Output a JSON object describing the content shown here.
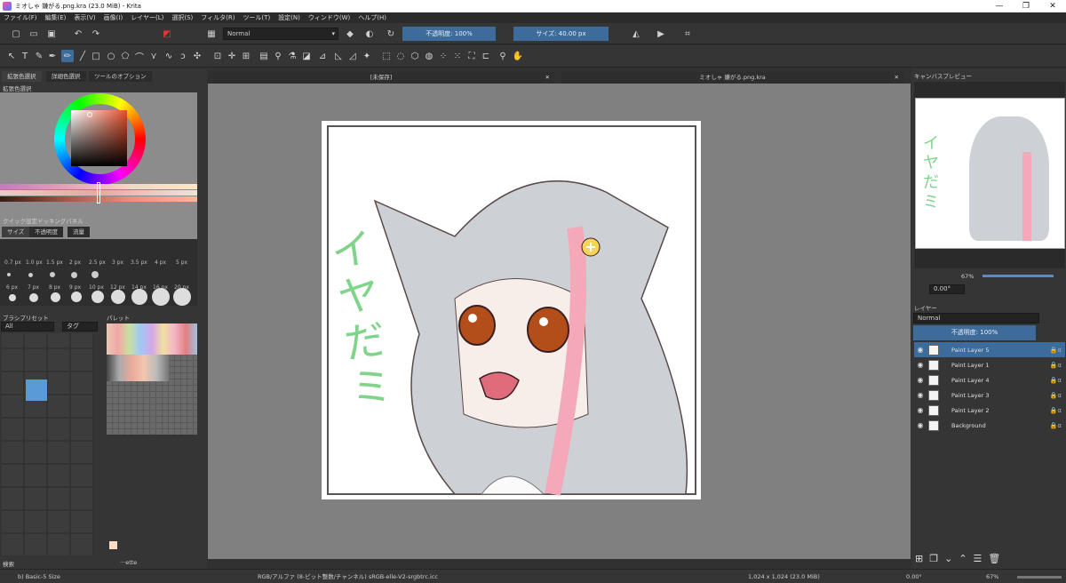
{
  "window": {
    "title": "ミオしゃ 嫌がる.png.kra (23.0 MiB) - Krita",
    "minimize": "—",
    "maximize": "❐",
    "close": "✕"
  },
  "menu": [
    "ファイル(F)",
    "編集(E)",
    "表示(V)",
    "画像(I)",
    "レイヤー(L)",
    "選択(S)",
    "フィルタ(R)",
    "ツール(T)",
    "設定(N)",
    "ウィンドウ(W)",
    "ヘルプ(H)"
  ],
  "toolbar": {
    "blend_mode": "Normal",
    "opacity_label": "不透明度: 100%",
    "size_label": "サイズ: 40.00 px"
  },
  "left": {
    "tabs": [
      "拡張色選択",
      "詳細色選択",
      "ツールのオプション"
    ],
    "color_selector_title": "拡張色選択",
    "quick_settings_title": "クイック設定ドッキングパネル",
    "quick_tabs": [
      "サイズ",
      "不透明度",
      "流量"
    ],
    "sizes_row1": [
      "0.7 px",
      "1.0 px",
      "1.5 px",
      "2 px",
      "2.5 px",
      "3 px",
      "3.5 px",
      "4 px",
      "5 px"
    ],
    "sizes_row2": [
      "6 px",
      "7 px",
      "8 px",
      "9 px",
      "10 px",
      "12 px",
      "14 px",
      "16 px",
      "20 px"
    ],
    "presets_title": "ブラシプリセット",
    "presets_filter": "All",
    "presets_tag": "タグ",
    "palette_title": "パレット",
    "search_label": "検索",
    "palette_name": "···ette"
  },
  "canvas": {
    "tab1": "[未保存]",
    "tab2": "ミオしゃ 嫌がる.png.kra",
    "artwork_text": "イヤだミ"
  },
  "right": {
    "preview_title": "キャンバスプレビュー",
    "zoom": "67%",
    "rotation": "0.00°",
    "layers_title": "レイヤー",
    "blend": "Normal",
    "opacity": "不透明度: 100%",
    "layers": [
      {
        "name": "Paint Layer 5",
        "selected": true
      },
      {
        "name": "Paint Layer 1",
        "selected": false
      },
      {
        "name": "Paint Layer 4",
        "selected": false
      },
      {
        "name": "Paint Layer 3",
        "selected": false
      },
      {
        "name": "Paint Layer 2",
        "selected": false
      },
      {
        "name": "Background",
        "selected": false
      }
    ]
  },
  "status": {
    "brush": "b) Basic-5 Size",
    "color": "RGB/アルファ (8-ビット整数/チャンネル)  sRGB-elle-V2-srgbtrc.icc",
    "dimensions": "1,024 x 1,024 (23.0 MiB)",
    "rotation": "0.00°",
    "zoom": "67%"
  },
  "colors": {
    "accent": "#3d6b9a",
    "fg_color": "#e8a99a",
    "canvas_bg": "#808080"
  }
}
